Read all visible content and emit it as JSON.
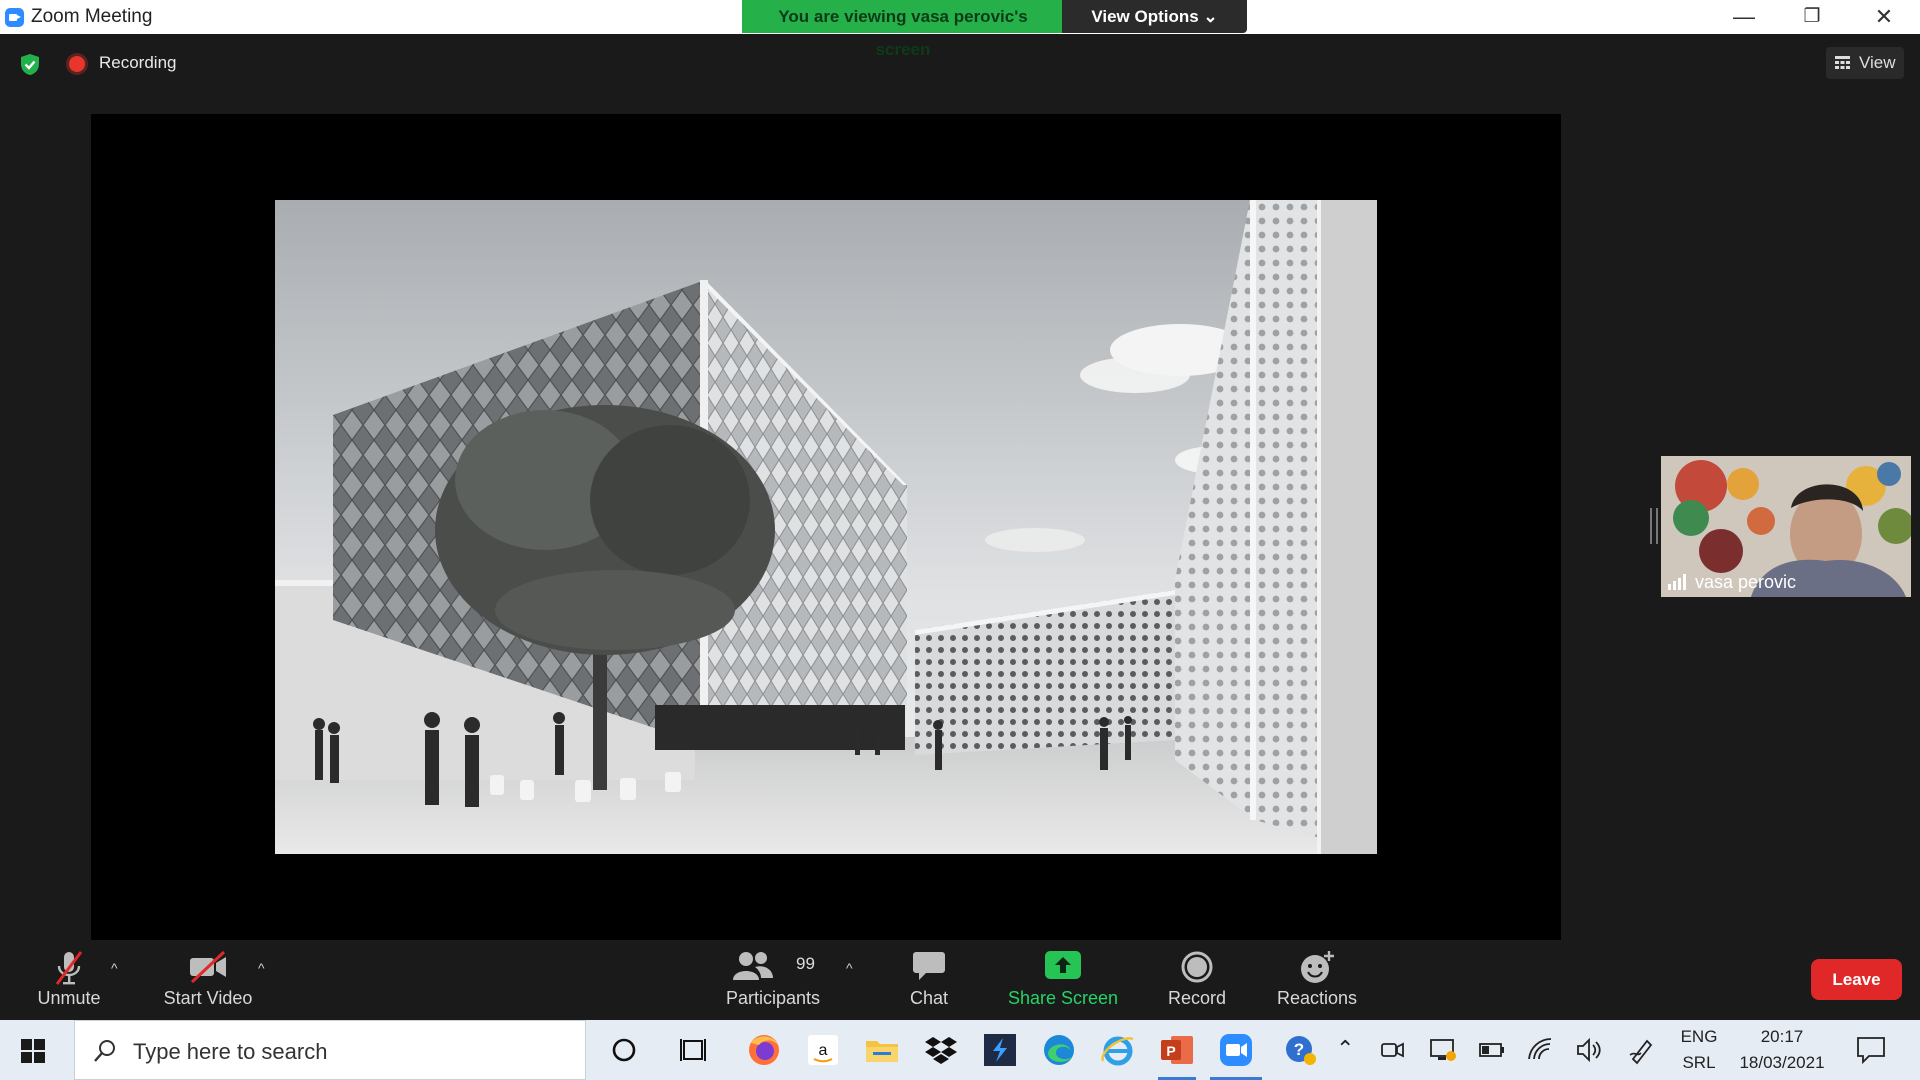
{
  "window": {
    "title": "Zoom Meeting",
    "minimize": "—",
    "restore": "❐",
    "close": "✕"
  },
  "banner": {
    "message": "You are viewing vasa perovic's screen",
    "options_label": "View Options ⌄"
  },
  "meeting_bar": {
    "recording_label": "Recording",
    "view_label": "View"
  },
  "shared_screen": {
    "content": "architectural rendering"
  },
  "participant_thumbnail": {
    "name": "vasa perovic"
  },
  "toolbar": {
    "unmute": "Unmute",
    "start_video": "Start Video",
    "participants": "Participants",
    "participant_count": "99",
    "chat": "Chat",
    "share_screen": "Share Screen",
    "record": "Record",
    "reactions": "Reactions",
    "leave": "Leave",
    "caret": "^"
  },
  "taskbar": {
    "search_placeholder": "Type here to search",
    "language_top": "ENG",
    "language_bottom": "SRL",
    "time": "20:17",
    "date": "18/03/2021"
  },
  "colors": {
    "accent": "#2d8cff",
    "banner_green": "#25b04a",
    "share_green": "#25d366",
    "leave_red": "#e02828",
    "record_red": "#e8362c"
  }
}
